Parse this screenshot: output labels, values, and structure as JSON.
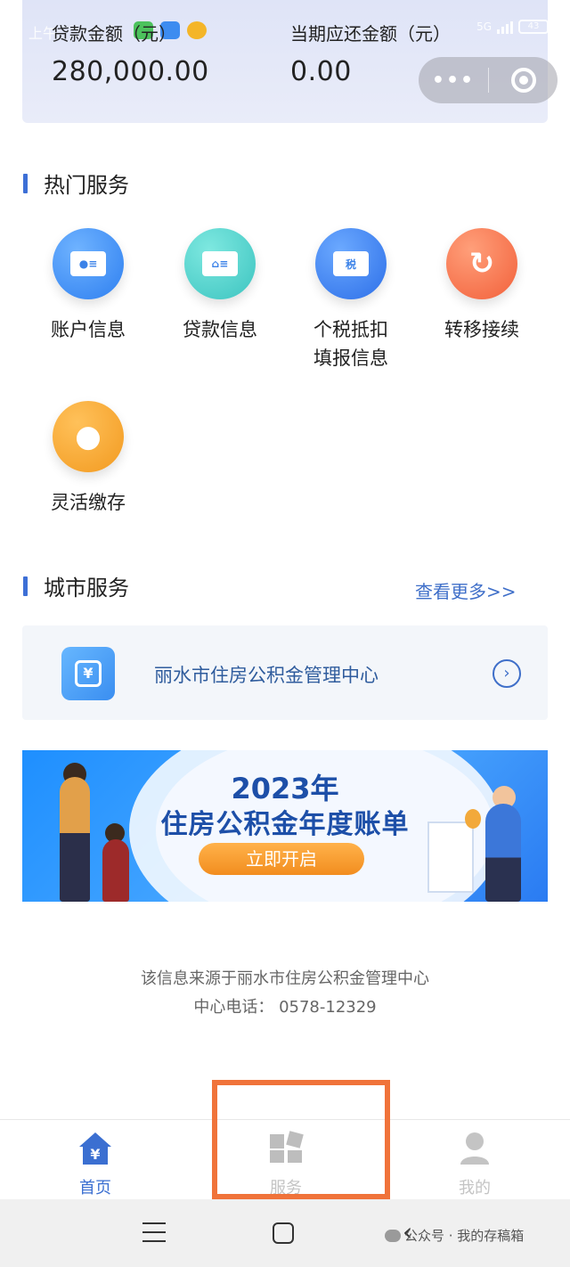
{
  "status_bar": {
    "left_text": "上午",
    "network": "5G",
    "battery": "43"
  },
  "loan_card": {
    "loan_amount_label": "贷款金额（元）",
    "loan_amount_value": "280,000.00",
    "due_amount_label": "当期应还金额（元）",
    "due_amount_value": "0.00"
  },
  "capsule": {
    "more": "•••"
  },
  "hot_services": {
    "title": "热门服务",
    "items": [
      {
        "label": "账户信息",
        "icon": "account-card-icon"
      },
      {
        "label": "贷款信息",
        "icon": "loan-house-card-icon"
      },
      {
        "label": "个税抵扣填报信息",
        "line1": "个税抵扣",
        "line2": "填报信息",
        "icon": "tax-card-icon",
        "icon_text": "税"
      },
      {
        "label": "转移接续",
        "icon": "transfer-icon"
      },
      {
        "label": "灵活缴存",
        "icon": "flexible-deposit-icon"
      }
    ]
  },
  "city_services": {
    "title": "城市服务",
    "more": "查看更多>>",
    "center_name": "丽水市住房公积金管理中心"
  },
  "banner": {
    "line1": "2023年",
    "line2": "住房公积金年度账单",
    "button": "立即开启"
  },
  "footer_info": {
    "source": "该信息来源于丽水市住房公积金管理中心",
    "phone": "中心电话： 0578-12329"
  },
  "tabbar": {
    "home": "首页",
    "services": "服务",
    "me": "我的"
  },
  "watermark": "公众号 · 我的存稿箱",
  "colors": {
    "accent": "#3b6fd1",
    "highlight": "#f0733a",
    "card_bg": "#e4e8f8"
  }
}
